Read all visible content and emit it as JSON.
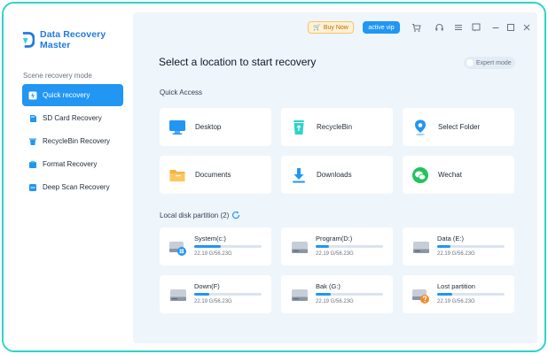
{
  "app": {
    "title": "Data Recovery Master"
  },
  "sidebar": {
    "section_title": "Scene recovery mode",
    "items": [
      {
        "label": "Quick recovery",
        "icon": "bolt-icon",
        "active": true
      },
      {
        "label": "SD Card Recovery",
        "icon": "sd-card-icon",
        "active": false
      },
      {
        "label": "RecycleBin Recovery",
        "icon": "recycle-bin-icon",
        "active": false
      },
      {
        "label": "Format Recovery",
        "icon": "format-icon",
        "active": false
      },
      {
        "label": "Deep Scan Recovery",
        "icon": "deep-scan-icon",
        "active": false
      }
    ]
  },
  "topbar": {
    "buy_label": "Buy Now",
    "vip_label": "active vip",
    "icons": [
      "cart-icon",
      "headset-icon",
      "menu-icon",
      "feedback-icon",
      "minimize-icon",
      "maximize-icon",
      "close-icon"
    ]
  },
  "main": {
    "title": "Select a location to start recovery",
    "expert_label": "Expert mode",
    "quick_access_title": "Quick Access",
    "quick_access": [
      {
        "label": "Desktop",
        "icon": "desktop-icon"
      },
      {
        "label": "RecycleBin",
        "icon": "recycle-bin-icon"
      },
      {
        "label": "Select Folder",
        "icon": "location-pin-icon"
      },
      {
        "label": "Documents",
        "icon": "folder-icon"
      },
      {
        "label": "Downloads",
        "icon": "download-icon"
      },
      {
        "label": "Wechat",
        "icon": "wechat-icon"
      }
    ],
    "disk_title": "Local disk partition (2)",
    "disks": [
      {
        "name": "System(c:)",
        "size": "22.19 G/56.23G",
        "used": 0.39,
        "icon": "system-drive-icon"
      },
      {
        "name": "Program(D:)",
        "size": "22.19 G/56.23G",
        "used": 0.2,
        "icon": "drive-icon"
      },
      {
        "name": "Data (E:)",
        "size": "22.19 G/56.23G",
        "used": 0.2,
        "icon": "drive-icon"
      },
      {
        "name": "Down(F)",
        "size": "22.19 G/56.23G",
        "used": 0.22,
        "icon": "drive-icon"
      },
      {
        "name": "Bak (G:)",
        "size": "22.19 G/56.23G",
        "used": 0.22,
        "icon": "drive-icon"
      },
      {
        "name": "Lost partition",
        "size": "22.19 G/56.23G",
        "used": 0.22,
        "icon": "lost-drive-icon"
      }
    ]
  },
  "colors": {
    "accent": "#2196f3",
    "brand": "#1f7ae0",
    "frame": "#2dd4c9",
    "panel": "#eef5fb"
  }
}
